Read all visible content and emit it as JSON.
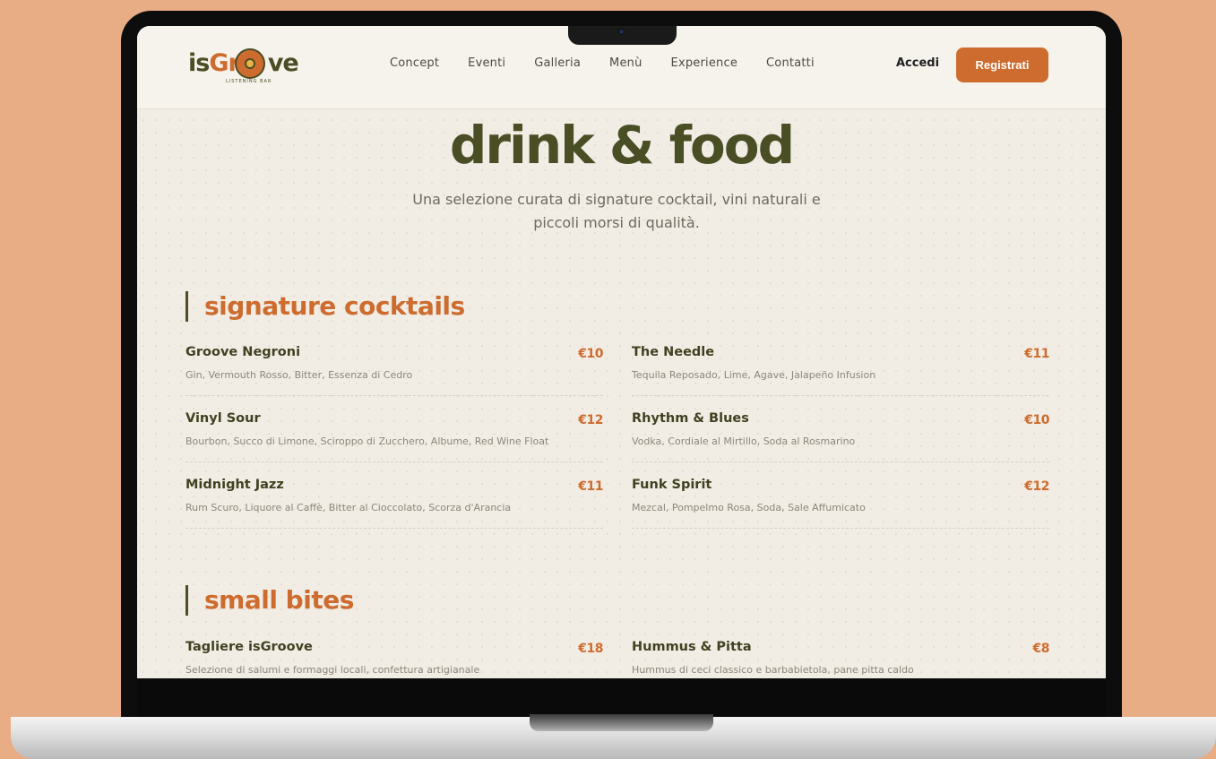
{
  "header": {
    "logo": {
      "text_a": "is",
      "text_b": "Gr",
      "text_c": "ve",
      "tagline": "LISTENING BAR"
    },
    "nav": [
      "Concept",
      "Eventi",
      "Galleria",
      "Menù",
      "Experience",
      "Contatti"
    ],
    "login_label": "Accedi",
    "register_label": "Registrati"
  },
  "hero": {
    "title": "drink & food",
    "subtitle": "Una selezione curata di signature cocktail, vini naturali e piccoli morsi di qualità."
  },
  "sections": [
    {
      "title": "signature cocktails",
      "items": [
        {
          "name": "Groove Negroni",
          "desc": "Gin, Vermouth Rosso, Bitter, Essenza di Cedro",
          "price": "€10"
        },
        {
          "name": "The Needle",
          "desc": "Tequila Reposado, Lime, Agave, Jalapeño Infusion",
          "price": "€11"
        },
        {
          "name": "Vinyl Sour",
          "desc": "Bourbon, Succo di Limone, Sciroppo di Zucchero, Albume, Red Wine Float",
          "price": "€12"
        },
        {
          "name": "Rhythm & Blues",
          "desc": "Vodka, Cordiale al Mirtillo, Soda al Rosmarino",
          "price": "€10"
        },
        {
          "name": "Midnight Jazz",
          "desc": "Rum Scuro, Liquore al Caffè, Bitter al Cioccolato, Scorza d'Arancia",
          "price": "€11"
        },
        {
          "name": "Funk Spirit",
          "desc": "Mezcal, Pompelmo Rosa, Soda, Sale Affumicato",
          "price": "€12"
        }
      ]
    },
    {
      "title": "small bites",
      "items": [
        {
          "name": "Tagliere isGroove",
          "desc": "Selezione di salumi e formaggi locali, confettura artigianale",
          "price": "€18"
        },
        {
          "name": "Hummus & Pitta",
          "desc": "Hummus di ceci classico e barbabietola, pane pitta caldo",
          "price": "€8"
        }
      ]
    }
  ],
  "colors": {
    "accent": "#cd6c2e",
    "olive": "#4a4e24",
    "background": "#e9ad86",
    "screen": "#f1ece4"
  }
}
